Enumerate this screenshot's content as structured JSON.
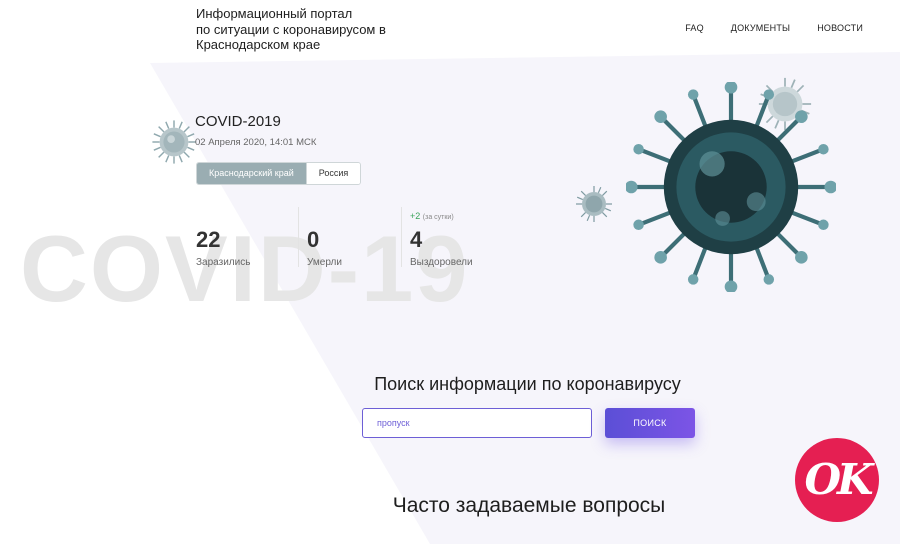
{
  "header": {
    "site_title_line1": "Информационный портал",
    "site_title_line2": "по ситуации с коронавирусом в",
    "site_title_line3": "Краснодарском крае",
    "nav": [
      "FAQ",
      "ДОКУМЕНТЫ",
      "НОВОСТИ"
    ]
  },
  "covid": {
    "title": "COVID-2019",
    "date": "02 Апреля 2020, 14:01 МСК",
    "tabs": [
      "Краснодарский край",
      "Россия"
    ],
    "active_tab": "Краснодарский край",
    "background_word": "COVID-19",
    "stats": [
      {
        "value": "22",
        "label": "Заразились"
      },
      {
        "value": "0",
        "label": "Умерли"
      },
      {
        "value": "4",
        "label": "Выздоровели"
      }
    ],
    "recovered_delta": "+2",
    "recovered_delta_note": "(за сутки)"
  },
  "search": {
    "heading": "Поиск информации по коронавирусу",
    "input_value": "пропуск",
    "button_label": "ПОИСК"
  },
  "faq": {
    "heading": "Часто задаваемые вопросы"
  },
  "watermark": {
    "logo_text": "OK"
  },
  "colors": {
    "accent": "#6d5fd6",
    "active_tab": "#9aadb2",
    "delta_green": "#3aa35b",
    "logo_red": "#e51f52"
  },
  "icons": {
    "virus_illustrations": "coronavirus-icon"
  }
}
